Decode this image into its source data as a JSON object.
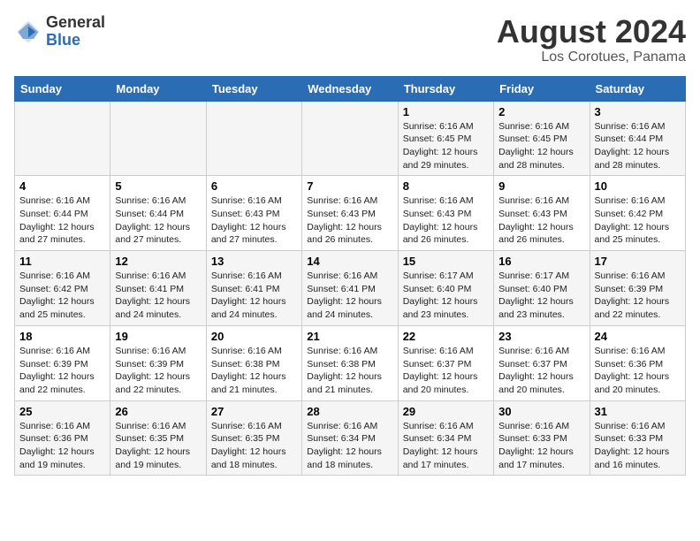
{
  "logo": {
    "general": "General",
    "blue": "Blue"
  },
  "title": "August 2024",
  "subtitle": "Los Corotues, Panama",
  "days_header": [
    "Sunday",
    "Monday",
    "Tuesday",
    "Wednesday",
    "Thursday",
    "Friday",
    "Saturday"
  ],
  "weeks": [
    [
      {
        "day": "",
        "info": ""
      },
      {
        "day": "",
        "info": ""
      },
      {
        "day": "",
        "info": ""
      },
      {
        "day": "",
        "info": ""
      },
      {
        "day": "1",
        "info": "Sunrise: 6:16 AM\nSunset: 6:45 PM\nDaylight: 12 hours\nand 29 minutes."
      },
      {
        "day": "2",
        "info": "Sunrise: 6:16 AM\nSunset: 6:45 PM\nDaylight: 12 hours\nand 28 minutes."
      },
      {
        "day": "3",
        "info": "Sunrise: 6:16 AM\nSunset: 6:44 PM\nDaylight: 12 hours\nand 28 minutes."
      }
    ],
    [
      {
        "day": "4",
        "info": "Sunrise: 6:16 AM\nSunset: 6:44 PM\nDaylight: 12 hours\nand 27 minutes."
      },
      {
        "day": "5",
        "info": "Sunrise: 6:16 AM\nSunset: 6:44 PM\nDaylight: 12 hours\nand 27 minutes."
      },
      {
        "day": "6",
        "info": "Sunrise: 6:16 AM\nSunset: 6:43 PM\nDaylight: 12 hours\nand 27 minutes."
      },
      {
        "day": "7",
        "info": "Sunrise: 6:16 AM\nSunset: 6:43 PM\nDaylight: 12 hours\nand 26 minutes."
      },
      {
        "day": "8",
        "info": "Sunrise: 6:16 AM\nSunset: 6:43 PM\nDaylight: 12 hours\nand 26 minutes."
      },
      {
        "day": "9",
        "info": "Sunrise: 6:16 AM\nSunset: 6:43 PM\nDaylight: 12 hours\nand 26 minutes."
      },
      {
        "day": "10",
        "info": "Sunrise: 6:16 AM\nSunset: 6:42 PM\nDaylight: 12 hours\nand 25 minutes."
      }
    ],
    [
      {
        "day": "11",
        "info": "Sunrise: 6:16 AM\nSunset: 6:42 PM\nDaylight: 12 hours\nand 25 minutes."
      },
      {
        "day": "12",
        "info": "Sunrise: 6:16 AM\nSunset: 6:41 PM\nDaylight: 12 hours\nand 24 minutes."
      },
      {
        "day": "13",
        "info": "Sunrise: 6:16 AM\nSunset: 6:41 PM\nDaylight: 12 hours\nand 24 minutes."
      },
      {
        "day": "14",
        "info": "Sunrise: 6:16 AM\nSunset: 6:41 PM\nDaylight: 12 hours\nand 24 minutes."
      },
      {
        "day": "15",
        "info": "Sunrise: 6:17 AM\nSunset: 6:40 PM\nDaylight: 12 hours\nand 23 minutes."
      },
      {
        "day": "16",
        "info": "Sunrise: 6:17 AM\nSunset: 6:40 PM\nDaylight: 12 hours\nand 23 minutes."
      },
      {
        "day": "17",
        "info": "Sunrise: 6:16 AM\nSunset: 6:39 PM\nDaylight: 12 hours\nand 22 minutes."
      }
    ],
    [
      {
        "day": "18",
        "info": "Sunrise: 6:16 AM\nSunset: 6:39 PM\nDaylight: 12 hours\nand 22 minutes."
      },
      {
        "day": "19",
        "info": "Sunrise: 6:16 AM\nSunset: 6:39 PM\nDaylight: 12 hours\nand 22 minutes."
      },
      {
        "day": "20",
        "info": "Sunrise: 6:16 AM\nSunset: 6:38 PM\nDaylight: 12 hours\nand 21 minutes."
      },
      {
        "day": "21",
        "info": "Sunrise: 6:16 AM\nSunset: 6:38 PM\nDaylight: 12 hours\nand 21 minutes."
      },
      {
        "day": "22",
        "info": "Sunrise: 6:16 AM\nSunset: 6:37 PM\nDaylight: 12 hours\nand 20 minutes."
      },
      {
        "day": "23",
        "info": "Sunrise: 6:16 AM\nSunset: 6:37 PM\nDaylight: 12 hours\nand 20 minutes."
      },
      {
        "day": "24",
        "info": "Sunrise: 6:16 AM\nSunset: 6:36 PM\nDaylight: 12 hours\nand 20 minutes."
      }
    ],
    [
      {
        "day": "25",
        "info": "Sunrise: 6:16 AM\nSunset: 6:36 PM\nDaylight: 12 hours\nand 19 minutes."
      },
      {
        "day": "26",
        "info": "Sunrise: 6:16 AM\nSunset: 6:35 PM\nDaylight: 12 hours\nand 19 minutes."
      },
      {
        "day": "27",
        "info": "Sunrise: 6:16 AM\nSunset: 6:35 PM\nDaylight: 12 hours\nand 18 minutes."
      },
      {
        "day": "28",
        "info": "Sunrise: 6:16 AM\nSunset: 6:34 PM\nDaylight: 12 hours\nand 18 minutes."
      },
      {
        "day": "29",
        "info": "Sunrise: 6:16 AM\nSunset: 6:34 PM\nDaylight: 12 hours\nand 17 minutes."
      },
      {
        "day": "30",
        "info": "Sunrise: 6:16 AM\nSunset: 6:33 PM\nDaylight: 12 hours\nand 17 minutes."
      },
      {
        "day": "31",
        "info": "Sunrise: 6:16 AM\nSunset: 6:33 PM\nDaylight: 12 hours\nand 16 minutes."
      }
    ]
  ]
}
